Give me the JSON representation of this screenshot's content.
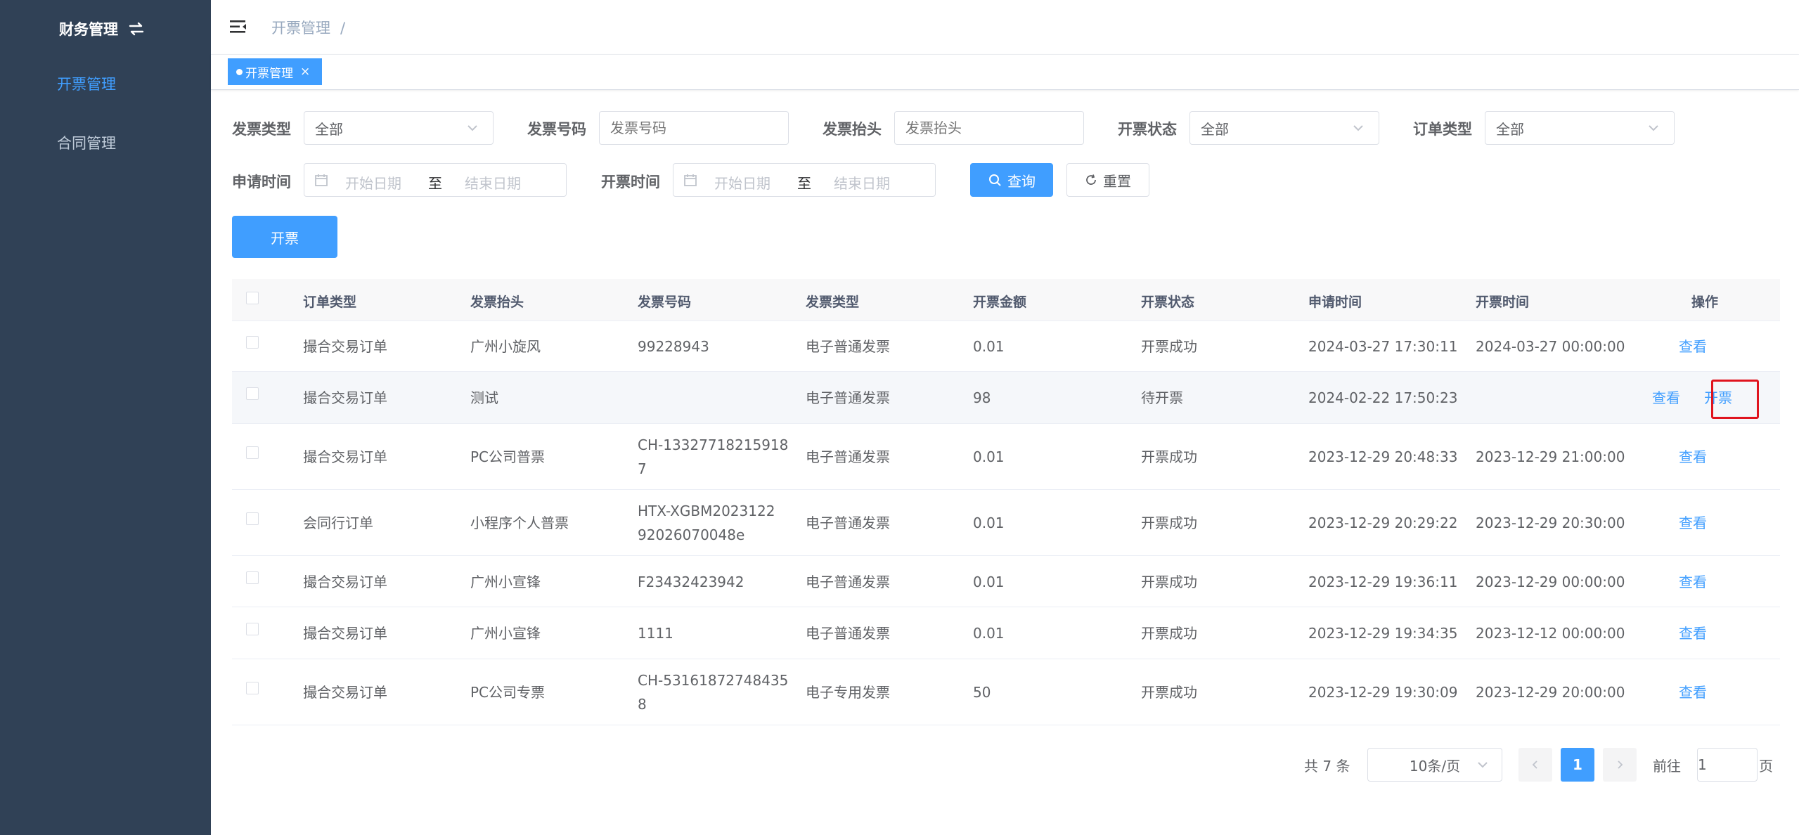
{
  "sidebar": {
    "title": "财务管理",
    "items": [
      {
        "label": "开票管理",
        "active": true
      },
      {
        "label": "合同管理",
        "active": false
      }
    ]
  },
  "header": {
    "breadcrumb": "开票管理",
    "breadcrumb_sep": "/"
  },
  "tags": [
    {
      "label": "开票管理",
      "close": "×"
    }
  ],
  "filters": {
    "invoice_type": {
      "label": "发票类型",
      "value": "全部"
    },
    "invoice_no": {
      "label": "发票号码",
      "placeholder": "发票号码"
    },
    "invoice_title": {
      "label": "发票抬头",
      "placeholder": "发票抬头"
    },
    "invoice_status": {
      "label": "开票状态",
      "value": "全部"
    },
    "order_type": {
      "label": "订单类型",
      "value": "全部"
    },
    "apply_time": {
      "label": "申请时间",
      "start": "开始日期",
      "to": "至",
      "end": "结束日期"
    },
    "issue_time": {
      "label": "开票时间",
      "start": "开始日期",
      "to": "至",
      "end": "结束日期"
    },
    "search_button": "查询",
    "reset_button": "重置"
  },
  "toolbar": {
    "issue_button": "开票"
  },
  "table": {
    "columns": [
      "订单类型",
      "发票抬头",
      "发票号码",
      "发票类型",
      "开票金额",
      "开票状态",
      "申请时间",
      "开票时间",
      "操作"
    ],
    "rows": [
      {
        "order_type": "撮合交易订单",
        "title": "广州小旋风",
        "number": [
          "99228943"
        ],
        "type": "电子普通发票",
        "amount": "0.01",
        "status": "开票成功",
        "apply_time": "2024-03-27 17:30:11",
        "issue_time": "2024-03-27 00:00:00",
        "actions": [
          "查看"
        ]
      },
      {
        "order_type": "撮合交易订单",
        "title": "测试",
        "number": [
          ""
        ],
        "type": "电子普通发票",
        "amount": "98",
        "status": "待开票",
        "apply_time": "2024-02-22 17:50:23",
        "issue_time": "",
        "actions": [
          "查看",
          "开票"
        ]
      },
      {
        "order_type": "撮合交易订单",
        "title": "PC公司普票",
        "number": [
          "CH-13327718215918",
          "7"
        ],
        "type": "电子普通发票",
        "amount": "0.01",
        "status": "开票成功",
        "apply_time": "2023-12-29 20:48:33",
        "issue_time": "2023-12-29 21:00:00",
        "actions": [
          "查看"
        ]
      },
      {
        "order_type": "会同行订单",
        "title": "小程序个人普票",
        "number": [
          "HTX-XGBM2023122",
          "92026070048e"
        ],
        "type": "电子普通发票",
        "amount": "0.01",
        "status": "开票成功",
        "apply_time": "2023-12-29 20:29:22",
        "issue_time": "2023-12-29 20:30:00",
        "actions": [
          "查看"
        ]
      },
      {
        "order_type": "撮合交易订单",
        "title": "广州小宣锋",
        "number": [
          "F23432423942"
        ],
        "type": "电子普通发票",
        "amount": "0.01",
        "status": "开票成功",
        "apply_time": "2023-12-29 19:36:11",
        "issue_time": "2023-12-29 00:00:00",
        "actions": [
          "查看"
        ]
      },
      {
        "order_type": "撮合交易订单",
        "title": "广州小宣锋",
        "number": [
          "1111"
        ],
        "type": "电子普通发票",
        "amount": "0.01",
        "status": "开票成功",
        "apply_time": "2023-12-29 19:34:35",
        "issue_time": "2023-12-12 00:00:00",
        "actions": [
          "查看"
        ]
      },
      {
        "order_type": "撮合交易订单",
        "title": "PC公司专票",
        "number": [
          "CH-53161872748435",
          "8"
        ],
        "type": "电子专用发票",
        "amount": "50",
        "status": "开票成功",
        "apply_time": "2023-12-29 19:30:09",
        "issue_time": "2023-12-29 20:00:00",
        "actions": [
          "查看"
        ]
      }
    ]
  },
  "pagination": {
    "total": "共 7 条",
    "page_size": "10条/页",
    "current_page": "1",
    "goto_prefix": "前往",
    "goto_value": "1",
    "goto_suffix": "页"
  },
  "colors": {
    "sidebar_bg": "#304156",
    "primary": "#409eff",
    "highlight_box": "#e0141e"
  }
}
